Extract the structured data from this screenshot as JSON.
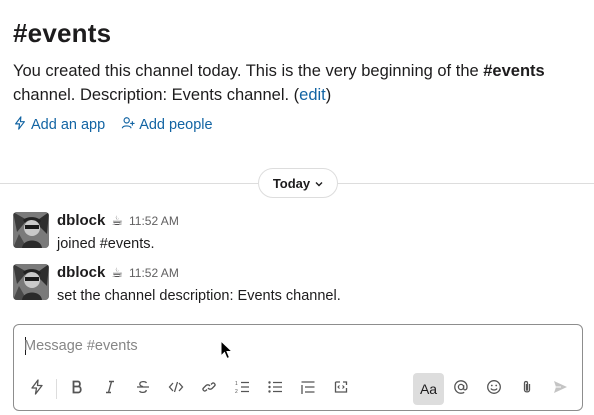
{
  "channel": {
    "title": "#events",
    "intro_prefix": "You created this channel today. This is the very beginning of the ",
    "intro_channel": "#events",
    "intro_suffix": " channel. Description: Events channel. (",
    "edit_link": "edit",
    "intro_close": ")",
    "actions": [
      {
        "label": "Add an app",
        "icon": "lightning-icon"
      },
      {
        "label": "Add people",
        "icon": "add-person-icon"
      }
    ]
  },
  "divider": {
    "label": "Today"
  },
  "messages": [
    {
      "author": "dblock",
      "status_emoji": "☕",
      "time": "11:52 AM",
      "text": "joined #events."
    },
    {
      "author": "dblock",
      "status_emoji": "☕",
      "time": "11:52 AM",
      "text": "set the channel description: Events channel."
    }
  ],
  "composer": {
    "placeholder": "Message #events",
    "value": "",
    "toolbar": [
      "shortcuts-icon",
      "bold-icon",
      "italic-icon",
      "strikethrough-icon",
      "code-icon",
      "link-icon",
      "ordered-list-icon",
      "bulleted-list-icon",
      "blockquote-icon",
      "code-block-icon",
      "formatting-toggle",
      "mention-icon",
      "emoji-icon",
      "attach-icon",
      "send-icon"
    ],
    "format_toggle_label": "Aa"
  },
  "colors": {
    "link": "#1264a3",
    "text": "#1d1c1d",
    "muted": "#616061",
    "divider": "#dddddd"
  }
}
